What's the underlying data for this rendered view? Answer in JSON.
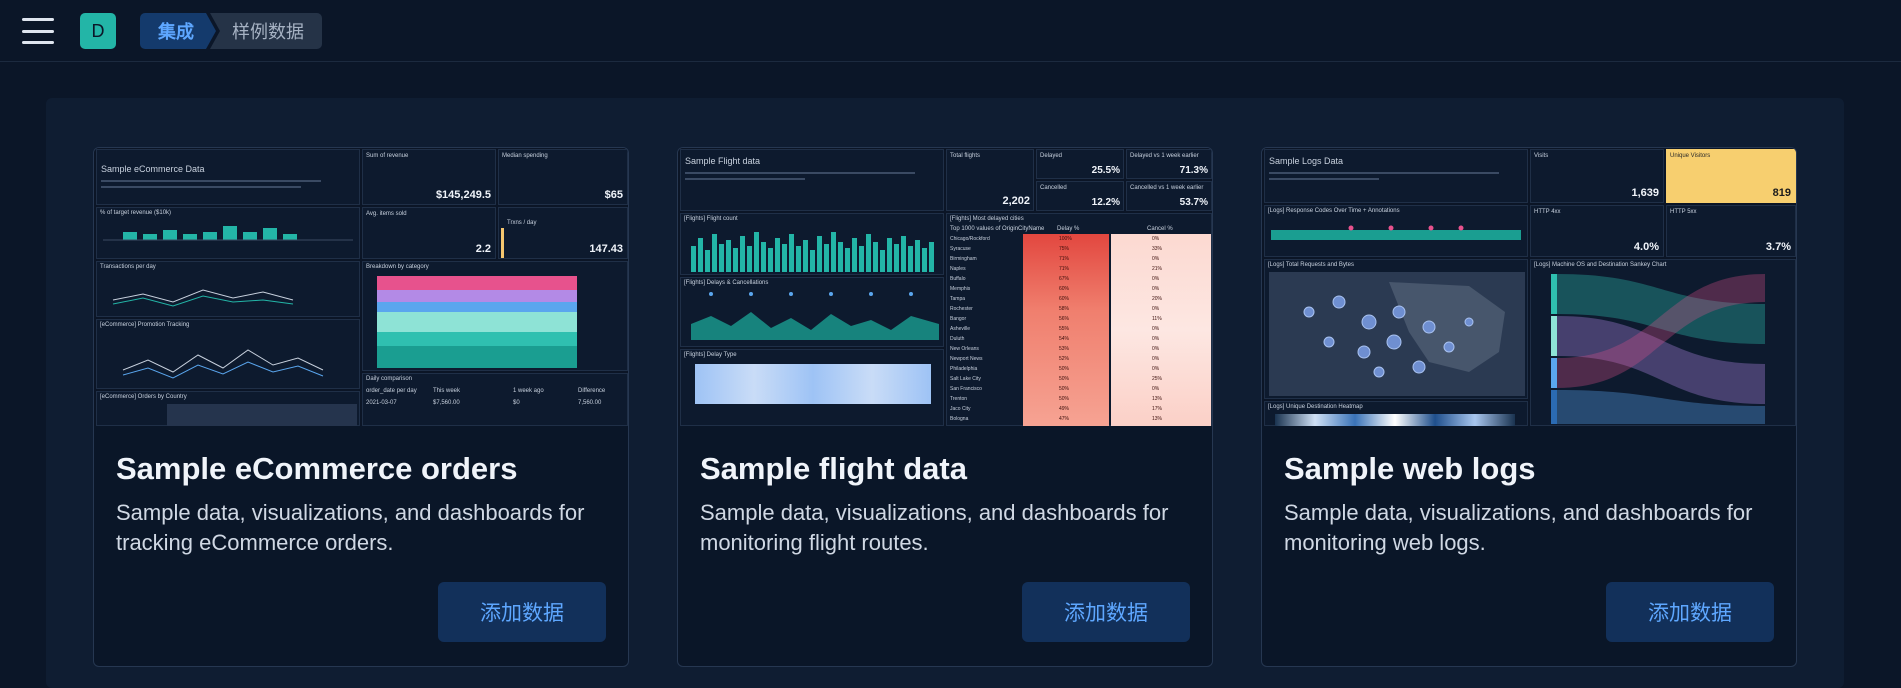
{
  "header": {
    "avatar_letter": "D",
    "breadcrumbs": [
      "集成",
      "样例数据"
    ]
  },
  "cards": [
    {
      "title": "Sample eCommerce orders",
      "description": "Sample data, visualizations, and dashboards for tracking eCommerce orders.",
      "button": "添加数据",
      "thumb": {
        "panel_title": "Sample eCommerce Data",
        "kpis": [
          {
            "label": "Sum of revenue",
            "value": "$145,249.5"
          },
          {
            "label": "Median spending",
            "value": "$65"
          },
          {
            "label": "Avg. items sold",
            "value": "2.2"
          },
          {
            "label": "Trxns / day",
            "value": "147.43"
          }
        ],
        "panels": [
          "% of target revenue ($10k)",
          "Transactions per day",
          "Breakdown by category",
          "[eCommerce] Promotion Tracking",
          "[eCommerce] Orders by Country",
          "Daily comparison"
        ],
        "table_headers": [
          "order_date per day",
          "This week",
          "1 week ago",
          "Difference"
        ],
        "table_row": [
          "2021-03-07",
          "$7,560.00",
          "$0",
          "7,560.00"
        ]
      }
    },
    {
      "title": "Sample flight data",
      "description": "Sample data, visualizations, and dashboards for monitoring flight routes.",
      "button": "添加数据",
      "thumb": {
        "panel_title": "Sample Flight data",
        "kpis": [
          {
            "label": "Total flights",
            "value": "2,202"
          },
          {
            "label": "Delayed",
            "value": "25.5%"
          },
          {
            "label": "Delayed vs 1 week earlier",
            "value": "71.3%"
          },
          {
            "label": "Cancelled",
            "value": "12.2%"
          },
          {
            "label": "Cancelled vs 1 week earlier",
            "value": "53.7%"
          }
        ],
        "panels": [
          "[Flights] Flight count",
          "[Flights] Delays & Cancellations",
          "[Flights] Delay Type",
          "[Flights] Most delayed cities"
        ],
        "table_headers": [
          "Top 1000 values of OriginCityName",
          "Delay %",
          "Cancel %"
        ],
        "cities": [
          "Chicago/Rockford",
          "Syracuse",
          "Birmingham",
          "Naples",
          "Buffalo",
          "Memphis",
          "Tampa",
          "Rochester",
          "Bangor",
          "Asheville",
          "Duluth",
          "New Orleans",
          "Newport News",
          "Philadelphia",
          "Salt Lake City",
          "San Francisco",
          "Trenton",
          "Jaco City",
          "Bologna"
        ],
        "delay": [
          "100%",
          "75%",
          "71%",
          "71%",
          "67%",
          "60%",
          "60%",
          "58%",
          "56%",
          "55%",
          "54%",
          "53%",
          "52%",
          "50%",
          "50%",
          "50%",
          "50%",
          "49%",
          "47%"
        ],
        "cancel": [
          "0%",
          "33%",
          "0%",
          "21%",
          "0%",
          "0%",
          "20%",
          "0%",
          "11%",
          "0%",
          "0%",
          "0%",
          "0%",
          "0%",
          "25%",
          "0%",
          "13%",
          "17%",
          "13%"
        ]
      }
    },
    {
      "title": "Sample web logs",
      "description": "Sample data, visualizations, and dashboards for monitoring web logs.",
      "button": "添加数据",
      "thumb": {
        "panel_title": "Sample Logs Data",
        "kpis": [
          {
            "label": "Visits",
            "value": "1,639"
          },
          {
            "label": "Unique Visitors",
            "value": "819"
          },
          {
            "label": "HTTP 4xx",
            "value": "4.0%"
          },
          {
            "label": "HTTP 5xx",
            "value": "3.7%"
          }
        ],
        "panels": [
          "[Logs] Response Codes Over Time + Annotations",
          "[Logs] Total Requests and Bytes",
          "[Logs] Machine OS and Destination Sankey Chart",
          "[Logs] Unique Destination Heatmap"
        ]
      }
    }
  ],
  "colors": {
    "background": "#0b1628",
    "card": "#0a1628",
    "accent": "#5ea7ff",
    "teal": "#23b5a7",
    "button_bg": "#12305a"
  }
}
